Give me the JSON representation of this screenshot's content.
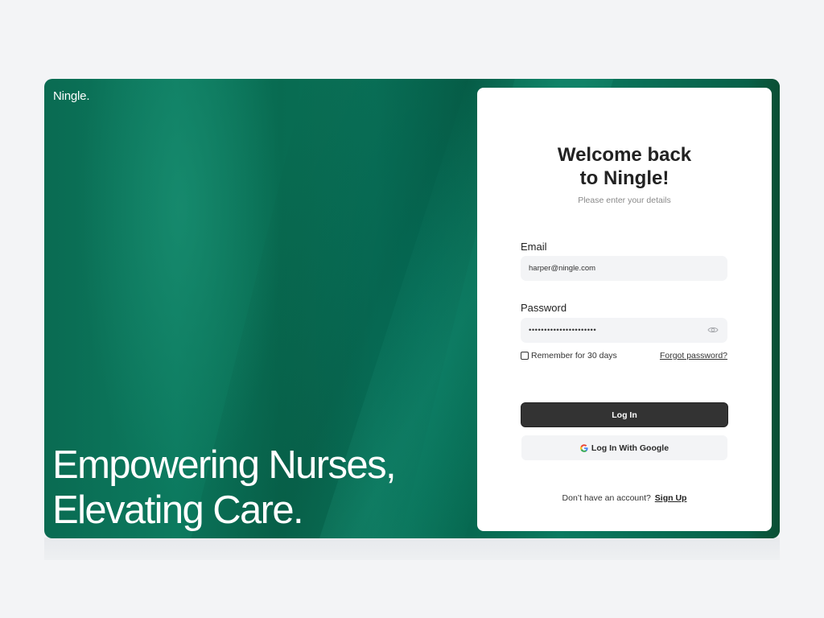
{
  "brand": {
    "logo_text": "Ningle.",
    "accent_color": "#0a7359"
  },
  "hero": {
    "tagline_line1": "Empowering Nurses,",
    "tagline_line2": "Elevating Care."
  },
  "login": {
    "title_line1": "Welcome back",
    "title_line2": "to Ningle!",
    "subtitle": "Please enter your details",
    "email_label": "Email",
    "email_value": "harper@ningle.com",
    "password_label": "Password",
    "password_value": "••••••••••••••••••••••",
    "password_toggle_icon": "eye-icon",
    "remember_label": "Remember for 30 days",
    "remember_checked": false,
    "forgot_label": "Forgot password?",
    "login_button": "Log In",
    "google_button": "Log In With Google",
    "google_icon": "google-icon",
    "signup_prompt": "Don’t have an account?",
    "signup_link": "Sign Up"
  }
}
